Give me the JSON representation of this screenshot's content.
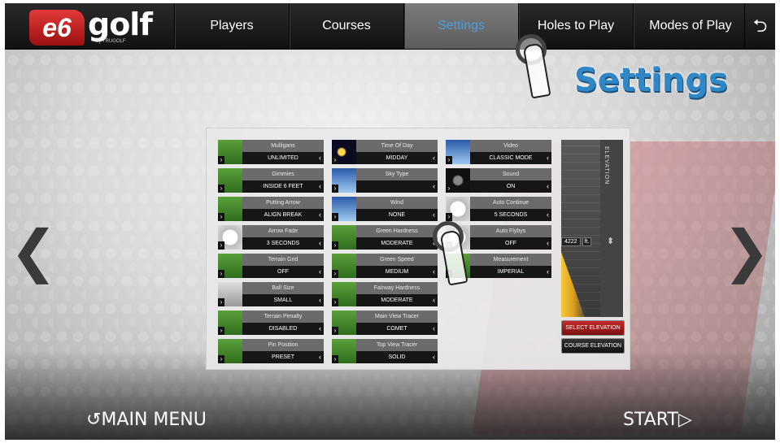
{
  "logo": {
    "mark": "e6",
    "word": "golf",
    "sub": "by TRUGOLF"
  },
  "nav": {
    "tabs": [
      "Players",
      "Courses",
      "Settings",
      "Holes to Play",
      "Modes of Play"
    ],
    "active": "Settings",
    "back_icon": "return-arrow-icon"
  },
  "page_title": "Settings",
  "arrows": {
    "left": "❮",
    "right": "❯"
  },
  "settings": {
    "col1": [
      {
        "label": "Mulligans",
        "value": "UNLIMITED",
        "icon": "golf-course-thumb"
      },
      {
        "label": "Gimmies",
        "value": "INSIDE 6 FEET",
        "icon": "golf-green-thumb"
      },
      {
        "label": "Putting Arrow",
        "value": "ALIGN BREAK",
        "icon": "putting-arrow-thumb"
      },
      {
        "label": "Arrow Fade",
        "value": "3 SECONDS",
        "icon": "timer-thumb"
      },
      {
        "label": "Terrain Grid",
        "value": "OFF",
        "icon": "terrain-thumb"
      },
      {
        "label": "Ball Size",
        "value": "SMALL",
        "icon": "ball-thumb"
      },
      {
        "label": "Terrain Penalty",
        "value": "DISABLED",
        "icon": "penalty-thumb"
      },
      {
        "label": "Pin Position",
        "value": "PRESET",
        "icon": "pin-thumb"
      }
    ],
    "col2": [
      {
        "label": "Time Of Day",
        "value": "MIDDAY",
        "icon": "sun-thumb"
      },
      {
        "label": "Sky Type",
        "value": "",
        "icon": "sky-thumb"
      },
      {
        "label": "Wind",
        "value": "NONE",
        "icon": "wind-thumb"
      },
      {
        "label": "Green Hardness",
        "value": "MODERATE",
        "icon": "green-thumb"
      },
      {
        "label": "Green Speed",
        "value": "MEDIUM",
        "icon": "speed-thumb"
      },
      {
        "label": "Fairway Hardness",
        "value": "MODERATE",
        "icon": "fairway-thumb"
      },
      {
        "label": "Main View Tracer",
        "value": "COMET",
        "icon": "tracer-thumb"
      },
      {
        "label": "Top View Tracer",
        "value": "SOLID",
        "icon": "topview-thumb"
      }
    ],
    "col3": [
      {
        "label": "Video",
        "value": "CLASSIC MODE",
        "icon": "video-thumb"
      },
      {
        "label": "Sound",
        "value": "ON",
        "icon": "speaker-thumb"
      },
      {
        "label": "Auto Continue",
        "value": "5 SECONDS",
        "icon": "gauge-thumb"
      },
      {
        "label": "Auto Flybys",
        "value": "OFF",
        "icon": "flyby-thumb"
      },
      {
        "label": "Measurement",
        "value": "IMPERIAL",
        "icon": "measure-thumb"
      }
    ]
  },
  "elevation": {
    "title": "ELEVATION",
    "value": "4222",
    "unit": "ft.",
    "select_btn": "SELECT ELEVATION",
    "course_btn": "COURSE ELEVATION"
  },
  "footer": {
    "main_menu": "↺MAIN MENU",
    "start": "START▷"
  }
}
